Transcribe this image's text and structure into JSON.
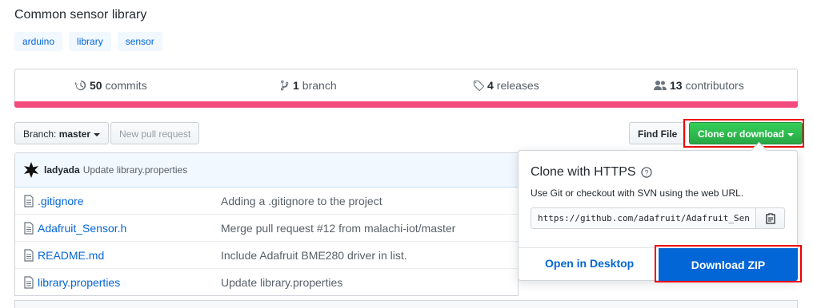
{
  "repo": {
    "description": "Common sensor library"
  },
  "topics": [
    "arduino",
    "library",
    "sensor"
  ],
  "summary": {
    "commits_count": "50",
    "commits_label": "commits",
    "branches_count": "1",
    "branches_label": "branch",
    "releases_count": "4",
    "releases_label": "releases",
    "contributors_count": "13",
    "contributors_label": "contributors",
    "language_bar_color": "#f34b7d"
  },
  "toolbar": {
    "branch_label": "Branch:",
    "branch_value": "master",
    "new_pr": "New pull request",
    "find_file": "Find File",
    "clone_download": "Clone or download"
  },
  "latest_commit": {
    "author": "ladyada",
    "message": "Update library.properties"
  },
  "files": [
    {
      "name": ".gitignore",
      "message": "Adding a .gitignore to the project"
    },
    {
      "name": "Adafruit_Sensor.h",
      "message": "Merge pull request #12 from malachi-iot/master"
    },
    {
      "name": "README.md",
      "message": "Include Adafruit BME280 driver in list."
    },
    {
      "name": "library.properties",
      "message": "Update library.properties"
    }
  ],
  "clone_popup": {
    "title": "Clone with HTTPS",
    "help": "Use Git or checkout with SVN using the web URL.",
    "url": "https://github.com/adafruit/Adafruit_Sensor.git",
    "open_desktop": "Open in Desktop",
    "download_zip": "Download ZIP"
  },
  "colors": {
    "accent": "#0366d6",
    "green": "#28a745",
    "highlight": "#ee0000"
  }
}
